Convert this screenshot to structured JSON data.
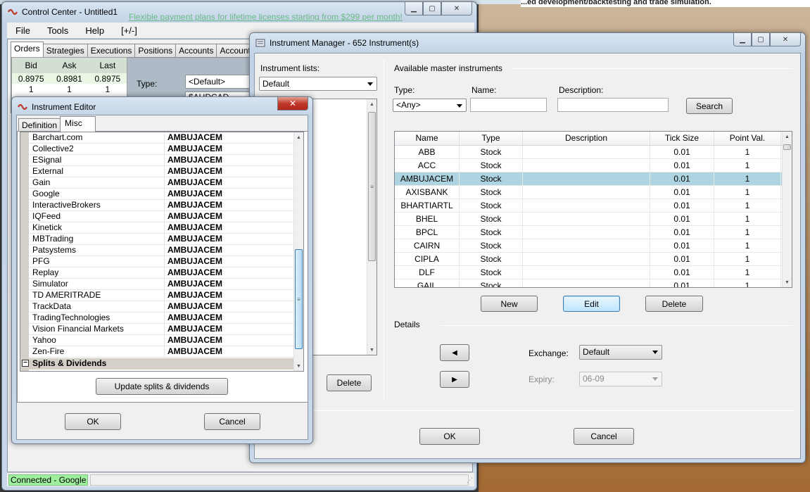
{
  "background": {
    "banner_text": "...ed development/backtesting and trade simulation.",
    "link_text": "Flexible payment plans for lifetime licenses starting from $299 per month!"
  },
  "control_center": {
    "title": "Control Center - Untitled1",
    "menu": [
      "File",
      "Tools",
      "Help",
      "[+/-]"
    ],
    "tabs": [
      "Orders",
      "Strategies",
      "Executions",
      "Positions",
      "Accounts",
      "Account Per"
    ],
    "active_tab": "Orders",
    "quote": {
      "headers": [
        "Bid",
        "Ask",
        "Last"
      ],
      "prices": [
        "0.8975",
        "0.8981",
        "0.8975"
      ],
      "sizes": [
        "1",
        "1",
        "1"
      ]
    },
    "type_label": "Type:",
    "type_value": "<Default>",
    "instrument_value": "$AUDCAD",
    "status": "Connected - Google"
  },
  "instrument_editor": {
    "title": "Instrument Editor",
    "tabs": [
      "Definition",
      "Misc"
    ],
    "active_tab": "Misc",
    "rows": [
      {
        "provider": "Barchart.com",
        "symbol": "AMBUJACEM"
      },
      {
        "provider": "Collective2",
        "symbol": "AMBUJACEM"
      },
      {
        "provider": "ESignal",
        "symbol": "AMBUJACEM"
      },
      {
        "provider": "External",
        "symbol": "AMBUJACEM"
      },
      {
        "provider": "Gain",
        "symbol": "AMBUJACEM"
      },
      {
        "provider": "Google",
        "symbol": "AMBUJACEM"
      },
      {
        "provider": "InteractiveBrokers",
        "symbol": "AMBUJACEM"
      },
      {
        "provider": "IQFeed",
        "symbol": "AMBUJACEM"
      },
      {
        "provider": "Kinetick",
        "symbol": "AMBUJACEM"
      },
      {
        "provider": "MBTrading",
        "symbol": "AMBUJACEM"
      },
      {
        "provider": "Patsystems",
        "symbol": "AMBUJACEM"
      },
      {
        "provider": "PFG",
        "symbol": "AMBUJACEM"
      },
      {
        "provider": "Replay",
        "symbol": "AMBUJACEM"
      },
      {
        "provider": "Simulator",
        "symbol": "AMBUJACEM"
      },
      {
        "provider": "TD AMERITRADE",
        "symbol": "AMBUJACEM"
      },
      {
        "provider": "TrackData",
        "symbol": "AMBUJACEM"
      },
      {
        "provider": "TradingTechnologies",
        "symbol": "AMBUJACEM"
      },
      {
        "provider": "Vision Financial Markets",
        "symbol": "AMBUJACEM"
      },
      {
        "provider": "Yahoo",
        "symbol": "AMBUJACEM"
      },
      {
        "provider": "Zen-Fire",
        "symbol": "AMBUJACEM"
      }
    ],
    "section": "Splits & Dividends",
    "update_button": "Update splits & dividends",
    "ok_button": "OK",
    "cancel_button": "Cancel"
  },
  "instrument_manager": {
    "title": "Instrument Manager - 652 Instrument(s)",
    "instrument_lists_label": "Instrument lists:",
    "instrument_list_value": "Default",
    "left_delete_button": "Delete",
    "master_group_label": "Available master instruments",
    "type_label": "Type:",
    "type_value": "<Any>",
    "name_label": "Name:",
    "name_value": "",
    "description_label": "Description:",
    "description_value": "",
    "search_button": "Search",
    "columns": [
      "Name",
      "Type",
      "Description",
      "Tick Size",
      "Point Val."
    ],
    "rows": [
      {
        "name": "ABB",
        "type": "Stock",
        "description": "",
        "tick": "0.01",
        "point": "1"
      },
      {
        "name": "ACC",
        "type": "Stock",
        "description": "",
        "tick": "0.01",
        "point": "1"
      },
      {
        "name": "AMBUJACEM",
        "type": "Stock",
        "description": "",
        "tick": "0.01",
        "point": "1"
      },
      {
        "name": "AXISBANK",
        "type": "Stock",
        "description": "",
        "tick": "0.01",
        "point": "1"
      },
      {
        "name": "BHARTIARTL",
        "type": "Stock",
        "description": "",
        "tick": "0.01",
        "point": "1"
      },
      {
        "name": "BHEL",
        "type": "Stock",
        "description": "",
        "tick": "0.01",
        "point": "1"
      },
      {
        "name": "BPCL",
        "type": "Stock",
        "description": "",
        "tick": "0.01",
        "point": "1"
      },
      {
        "name": "CAIRN",
        "type": "Stock",
        "description": "",
        "tick": "0.01",
        "point": "1"
      },
      {
        "name": "CIPLA",
        "type": "Stock",
        "description": "",
        "tick": "0.01",
        "point": "1"
      },
      {
        "name": "DLF",
        "type": "Stock",
        "description": "",
        "tick": "0.01",
        "point": "1"
      },
      {
        "name": "GAIL",
        "type": "Stock",
        "description": "",
        "tick": "0.01",
        "point": "1"
      }
    ],
    "selected_row": "AMBUJACEM",
    "new_button": "New",
    "edit_button": "Edit",
    "delete_button": "Delete",
    "details_label": "Details",
    "exchange_label": "Exchange:",
    "exchange_value": "Default",
    "expiry_label": "Expiry:",
    "expiry_value": "06-09",
    "ok_button": "OK",
    "cancel_button": "Cancel"
  }
}
